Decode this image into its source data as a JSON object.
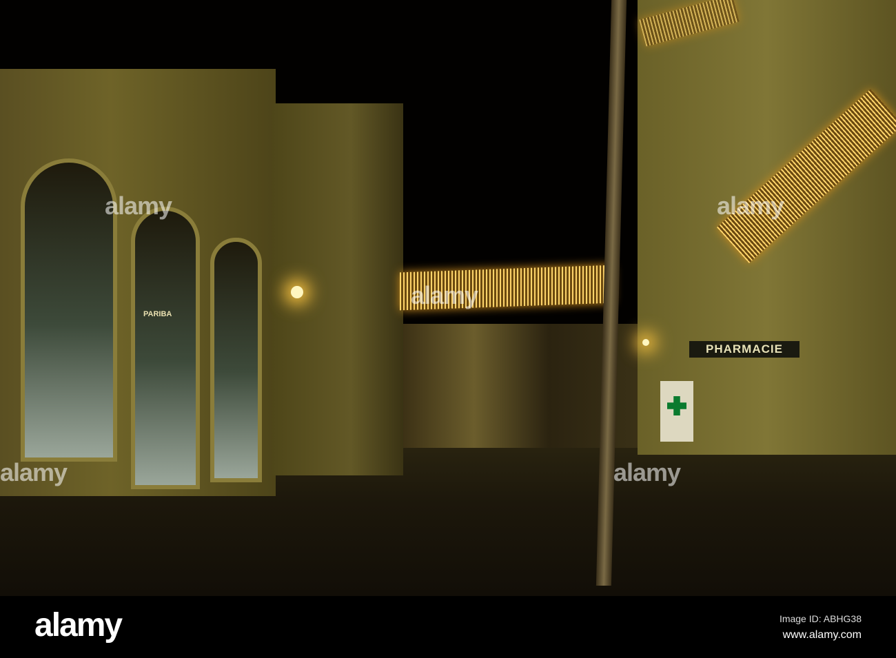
{
  "photo": {
    "shop_sign": "PHARMACIE",
    "bank_sign": "PARIBA"
  },
  "watermark": {
    "overlay_text": "alamy",
    "logo": "alamy",
    "image_id": "Image ID: ABHG38",
    "url": "www.alamy.com"
  }
}
